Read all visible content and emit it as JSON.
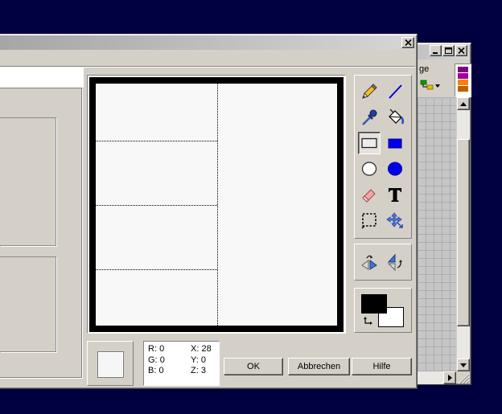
{
  "canvas": {
    "frame_color": "#000000",
    "fill_color": "#f8f8f8"
  },
  "tools": {
    "selected": "rectangle",
    "items": [
      {
        "id": "pencil",
        "icon": "pencil-icon"
      },
      {
        "id": "line",
        "icon": "line-icon"
      },
      {
        "id": "eyedropper",
        "icon": "eyedropper-icon"
      },
      {
        "id": "fill",
        "icon": "fill-bucket-icon"
      },
      {
        "id": "rectangle",
        "icon": "rectangle-icon"
      },
      {
        "id": "filled-rectangle",
        "icon": "filled-rectangle-icon"
      },
      {
        "id": "ellipse",
        "icon": "ellipse-icon"
      },
      {
        "id": "filled-ellipse",
        "icon": "filled-ellipse-icon"
      },
      {
        "id": "eraser",
        "icon": "eraser-icon"
      },
      {
        "id": "text",
        "icon": "text-icon"
      },
      {
        "id": "select",
        "icon": "selection-icon"
      },
      {
        "id": "move",
        "icon": "move-icon"
      }
    ]
  },
  "transform_tools": [
    {
      "id": "flip-horizontal",
      "icon": "flip-horizontal-icon"
    },
    {
      "id": "flip-vertical",
      "icon": "flip-vertical-icon"
    }
  ],
  "colors": {
    "foreground": "#000000",
    "background": "#ffffff",
    "swap_icon": "swap-colors-icon"
  },
  "info": {
    "r": {
      "label": "R:",
      "value": "0"
    },
    "g": {
      "label": "G:",
      "value": "0"
    },
    "b": {
      "label": "B:",
      "value": "0"
    },
    "x": {
      "label": "X:",
      "value": "28"
    },
    "y": {
      "label": "Y:",
      "value": "0"
    },
    "z": {
      "label": "Z:",
      "value": "3"
    }
  },
  "buttons": {
    "ok": "OK",
    "cancel": "Abbrechen",
    "help": "Hilfe"
  },
  "back_window": {
    "menu_label": "ge",
    "palette": [
      "#800080",
      "#a000a0",
      "#ff8000",
      "#c06000"
    ],
    "caption_icons": [
      "minimize-icon",
      "maximize-icon",
      "close-icon"
    ]
  }
}
